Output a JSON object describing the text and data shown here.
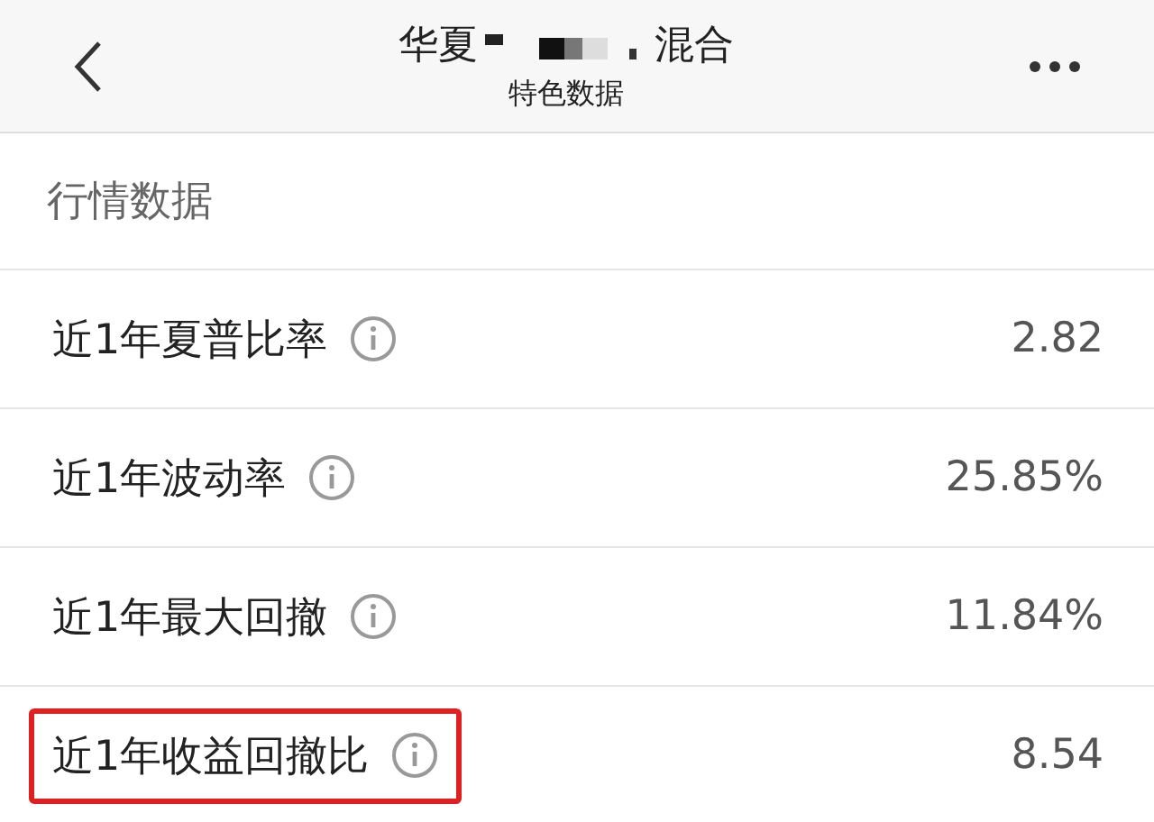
{
  "header": {
    "title_start": "华夏",
    "title_end": "混合",
    "subtitle": "特色数据"
  },
  "section": {
    "title": "行情数据"
  },
  "rows": [
    {
      "label": "近1年夏普比率",
      "value": "2.82",
      "highlighted": false
    },
    {
      "label": "近1年波动率",
      "value": "25.85%",
      "highlighted": false
    },
    {
      "label": "近1年最大回撤",
      "value": "11.84%",
      "highlighted": false
    },
    {
      "label": "近1年收益回撤比",
      "value": "8.54",
      "highlighted": true
    }
  ]
}
